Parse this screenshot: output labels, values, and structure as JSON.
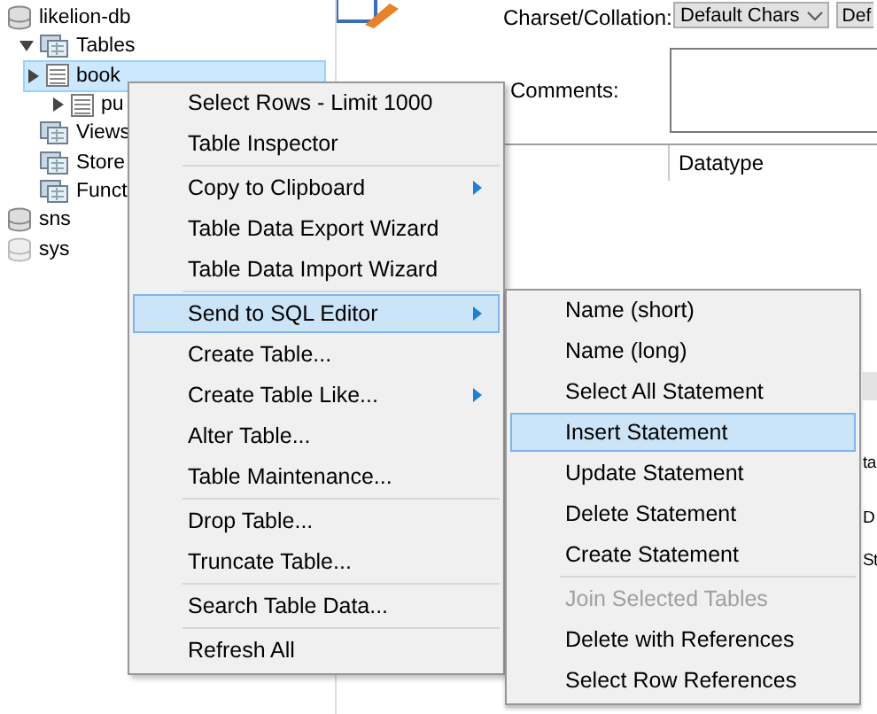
{
  "tree": [
    {
      "name": "likelion-db",
      "kind": "schema",
      "dimmed": false,
      "children": [
        {
          "name": "Tables",
          "kind": "folder",
          "expanded": true,
          "children": [
            {
              "name": "book",
              "kind": "table",
              "expanded": false,
              "selected": true
            },
            {
              "name": "pu",
              "kind": "table",
              "expanded": false,
              "selected": false
            }
          ]
        },
        {
          "name": "Views",
          "kind": "folder"
        },
        {
          "name": "Store",
          "kind": "folder"
        },
        {
          "name": "Funct",
          "kind": "folder"
        }
      ]
    },
    {
      "name": "sns",
      "kind": "schema",
      "dimmed": false
    },
    {
      "name": "sys",
      "kind": "schema",
      "dimmed": true
    }
  ],
  "editor": {
    "charset_label": "Charset/Collation:",
    "charset_select": "Default Chars",
    "collation_select": "Def",
    "comments_label": "Comments:",
    "column_header": "Datatype",
    "partial_cells": [
      "ta",
      "D",
      "St"
    ]
  },
  "context_menu": [
    {
      "kind": "item",
      "label": "Select Rows - Limit 1000",
      "selected": false,
      "submenu": false
    },
    {
      "kind": "item",
      "label": "Table Inspector",
      "selected": false,
      "submenu": false
    },
    {
      "kind": "separator"
    },
    {
      "kind": "item",
      "label": "Copy to Clipboard",
      "selected": false,
      "submenu": true
    },
    {
      "kind": "item",
      "label": "Table Data Export Wizard",
      "selected": false,
      "submenu": false
    },
    {
      "kind": "item",
      "label": "Table Data Import Wizard",
      "selected": false,
      "submenu": false
    },
    {
      "kind": "separator"
    },
    {
      "kind": "item",
      "label": "Send to SQL Editor",
      "selected": true,
      "submenu": true
    },
    {
      "kind": "item",
      "label": "Create Table...",
      "selected": false,
      "submenu": false
    },
    {
      "kind": "item",
      "label": "Create Table Like...",
      "selected": false,
      "submenu": true
    },
    {
      "kind": "item",
      "label": "Alter Table...",
      "selected": false,
      "submenu": false
    },
    {
      "kind": "item",
      "label": "Table Maintenance...",
      "selected": false,
      "submenu": false
    },
    {
      "kind": "separator"
    },
    {
      "kind": "item",
      "label": "Drop Table...",
      "selected": false,
      "submenu": false
    },
    {
      "kind": "item",
      "label": "Truncate Table...",
      "selected": false,
      "submenu": false
    },
    {
      "kind": "separator"
    },
    {
      "kind": "item",
      "label": "Search Table Data...",
      "selected": false,
      "submenu": false
    },
    {
      "kind": "separator"
    },
    {
      "kind": "item",
      "label": "Refresh All",
      "selected": false,
      "submenu": false
    }
  ],
  "submenu": [
    {
      "kind": "item",
      "label": "Name (short)",
      "selected": false,
      "disabled": false
    },
    {
      "kind": "item",
      "label": "Name (long)",
      "selected": false,
      "disabled": false
    },
    {
      "kind": "item",
      "label": "Select All Statement",
      "selected": false,
      "disabled": false
    },
    {
      "kind": "item",
      "label": "Insert Statement",
      "selected": true,
      "disabled": false
    },
    {
      "kind": "item",
      "label": "Update Statement",
      "selected": false,
      "disabled": false
    },
    {
      "kind": "item",
      "label": "Delete Statement",
      "selected": false,
      "disabled": false
    },
    {
      "kind": "item",
      "label": "Create Statement",
      "selected": false,
      "disabled": false
    },
    {
      "kind": "separator"
    },
    {
      "kind": "item",
      "label": "Join Selected Tables",
      "selected": false,
      "disabled": true
    },
    {
      "kind": "item",
      "label": "Delete with References",
      "selected": false,
      "disabled": false
    },
    {
      "kind": "item",
      "label": "Select Row References",
      "selected": false,
      "disabled": false
    }
  ]
}
